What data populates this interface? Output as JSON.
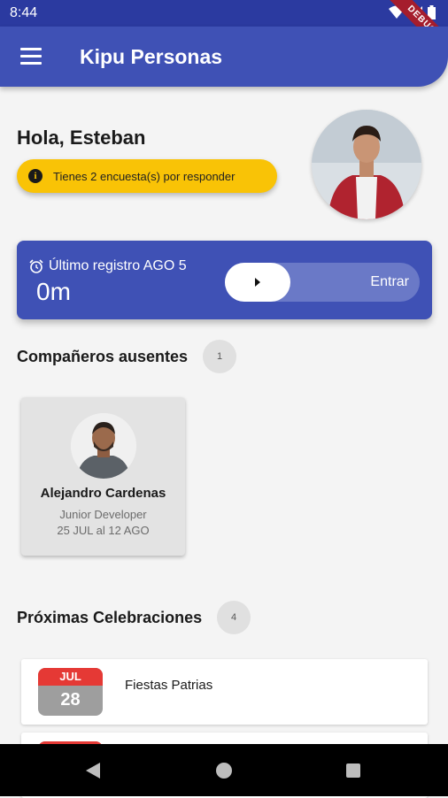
{
  "status_bar": {
    "time": "8:44",
    "debug_label": "DEBUG"
  },
  "app_bar": {
    "title": "Kipu Personas",
    "menu_icon": "hamburger-icon"
  },
  "greeting": {
    "text": "Hola, Esteban",
    "survey_badge": "Tienes 2 encuesta(s) por responder"
  },
  "clock": {
    "label": "Último registro AGO 5",
    "elapsed": "0m",
    "slider_label": "Entrar"
  },
  "absent": {
    "title": "Compañeros ausentes",
    "count": "1",
    "people": [
      {
        "name": "Alejandro Cardenas",
        "role": "Junior Developer",
        "range": "25 JUL al 12 AGO"
      }
    ]
  },
  "celebrations": {
    "title": "Próximas Celebraciones",
    "count": "4",
    "items": [
      {
        "month": "JUL",
        "day": "28",
        "name": "Fiestas Patrias"
      },
      {
        "month": "",
        "day": "",
        "name": ""
      }
    ]
  },
  "colors": {
    "primary": "#3f51b5",
    "status_bar": "#2b3aa0",
    "survey_badge": "#f9c306",
    "calendar_header": "#e53935"
  }
}
